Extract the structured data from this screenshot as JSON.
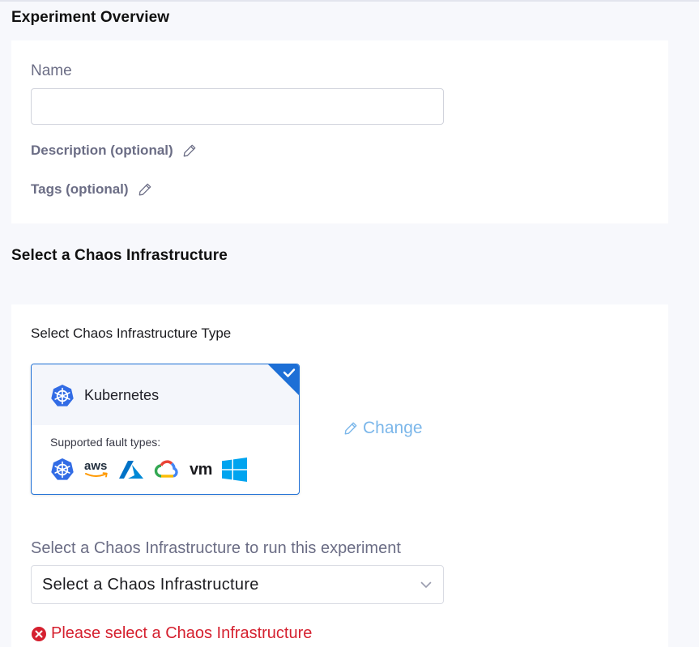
{
  "overview": {
    "title": "Experiment Overview",
    "name_label": "Name",
    "name_value": "",
    "name_placeholder": "",
    "description_label": "Description (optional)",
    "tags_label": "Tags (optional)"
  },
  "infrastructure": {
    "title": "Select a Chaos Infrastructure",
    "type_heading": "Select Chaos Infrastructure Type",
    "selected_type": {
      "name": "Kubernetes",
      "icon": "kubernetes-icon",
      "checked": true,
      "supported_label": "Supported fault types:",
      "fault_types": [
        "kubernetes-icon",
        "aws-logo-icon",
        "azure-logo-icon",
        "google-cloud-logo-icon",
        "vmware-logo-icon",
        "windows-logo-icon"
      ],
      "aws_text": "aws",
      "vm_text": "vm"
    },
    "change_label": "Change",
    "select_label": "Select a Chaos Infrastructure to run this experiment",
    "select_value": "Select a Chaos Infrastructure",
    "error_message": "Please select a Chaos Infrastructure"
  },
  "colors": {
    "accent": "#1d6fd6",
    "error": "#d5202f",
    "link_muted": "#7cb7ea",
    "label_gray": "#6b6d85"
  }
}
